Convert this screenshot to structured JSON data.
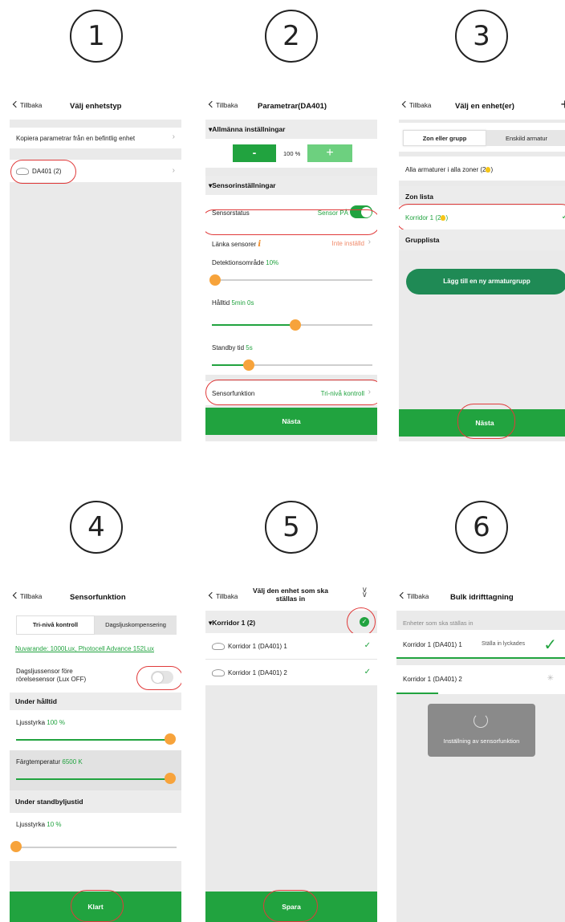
{
  "step_numbers": [
    "1",
    "2",
    "3",
    "4",
    "5",
    "6"
  ],
  "common": {
    "back_label": "Tillbaka"
  },
  "s1": {
    "title": "Välj enhetstyp",
    "copy_label": "Kopiera parametrar från en befintlig enhet",
    "device_label": "DA401 (2)"
  },
  "s2": {
    "title": "Parametrar(DA401)",
    "general_section": "▾Allmänna inställningar",
    "minus": "-",
    "level": "100 %",
    "plus": "+",
    "sensor_section": "▾Sensorinställningar",
    "status_label": "Sensorstatus",
    "status_value": "Sensor PÅ",
    "link_label": "Länka sensorer",
    "link_value": "Inte inställd",
    "detect_label": "Detektionsområde",
    "detect_value": "10%",
    "detect_level": 0.02,
    "hold_label": "Hålltid",
    "hold_value": "5min 0s",
    "hold_level": 0.52,
    "standby_label": "Standby tid",
    "standby_value": "5s",
    "standby_level": 0.23,
    "func_label": "Sensorfunktion",
    "func_value": "Tri-nivå kontroll",
    "next_label": "Nästa"
  },
  "s3": {
    "title": "Välj en enhet(er)",
    "plus": "+",
    "tab_zone": "Zon eller grupp",
    "tab_single": "Enskild armatur",
    "all_label": "Alla armaturer i alla zoner (2",
    "all_close": ")",
    "zone_list": "Zon lista",
    "zone_item": "Korridor 1 (2",
    "zone_item_close": ")",
    "check": "✓",
    "group_list": "Grupplista",
    "add_group": "Lägg till en ny armaturgrupp",
    "next_label": "Nästa"
  },
  "s4": {
    "title": "Sensorfunktion",
    "tab_tri": "Tri-nivå kontroll",
    "tab_daylight": "Dagsljuskompensering",
    "current_link": "Nuvarande: 1000Lux, Photocell Advance 152Lux",
    "daylight_label": "Dagsljussensor före rörelsesensor (Lux OFF)",
    "under_hold": "Under hålltid",
    "bright_label": "Ljusstyrka",
    "bright_value": "100 %",
    "bright_level": 1.0,
    "temp_label": "Färgtemperatur",
    "temp_value": "6500 K",
    "temp_level": 1.0,
    "under_standby": "Under standbyljustid",
    "bright2_label": "Ljusstyrka",
    "bright2_value": "10 %",
    "bright2_level": 0.0,
    "done_label": "Klart"
  },
  "s5": {
    "title": "Välj den enhet som ska ställas in",
    "group_label": "▾Korridor 1 (2)",
    "item1": "Korridor 1 (DA401) 1",
    "item2": "Korridor 1 (DA401) 2",
    "check": "✓",
    "save_label": "Spara"
  },
  "s6": {
    "title": "Bulk idrifttagning",
    "section": "Enheter som ska ställas in",
    "item1": "Korridor 1 (DA401) 1",
    "item1_status": "Ställa in lyckades",
    "item2": "Korridor 1 (DA401) 2",
    "toast": "Inställning av sensorfunktion"
  }
}
